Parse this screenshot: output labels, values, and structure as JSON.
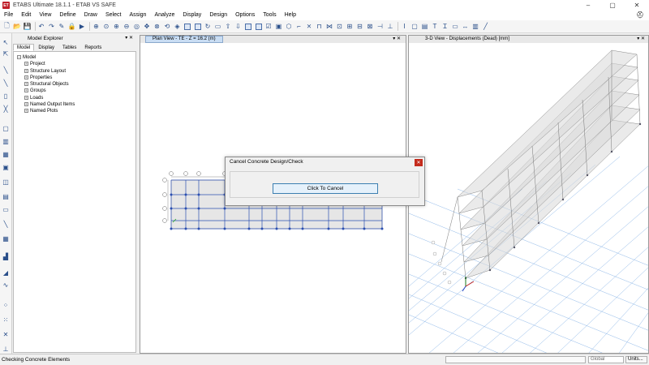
{
  "window": {
    "title": "ETABS Ultimate 18.1.1 - ETAB VS SAFE",
    "icon_label": "ET",
    "minimize": "–",
    "maximize": "▢",
    "close": "✕"
  },
  "menu": [
    "File",
    "Edit",
    "View",
    "Define",
    "Draw",
    "Select",
    "Assign",
    "Analyze",
    "Display",
    "Design",
    "Options",
    "Tools",
    "Help"
  ],
  "model_explorer": {
    "title": "Model Explorer",
    "pin": "▾ ✕",
    "tabs": [
      "Model",
      "Display",
      "Tables",
      "Reports"
    ],
    "active_tab": "Model",
    "root": "Model",
    "items": [
      "Project",
      "Structure Layout",
      "Properties",
      "Structural Objects",
      "Groups",
      "Loads",
      "Named Output Items",
      "Named Plots"
    ]
  },
  "plan_view": {
    "title": "Plan View - TE - Z = 16.2 (m)",
    "buttons": "▾ ✕"
  },
  "view_3d": {
    "title": "3-D View  - Displacements (Dead)  [mm]",
    "buttons": "▾ ✕"
  },
  "dialog": {
    "title": "Cancel Concrete Design/Check",
    "close": "✕",
    "button": "Click To Cancel"
  },
  "status": {
    "text": "Checking Concrete Elements",
    "coord_system": "Global",
    "units": "Units..."
  },
  "colors": {
    "accent": "#3c7fb1",
    "close_red": "#c42b1c",
    "grid_blue": "#2b4fb0",
    "grid_light": "#8fb8e8"
  }
}
